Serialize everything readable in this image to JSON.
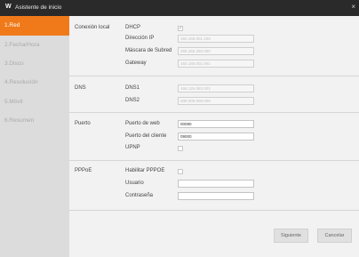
{
  "window": {
    "logo": "W",
    "title": "Asistente de inicio",
    "close_glyph": "×"
  },
  "sidebar": {
    "items": [
      {
        "label": "1.Red",
        "active": true
      },
      {
        "label": "2.Fecha/Hora",
        "active": false
      },
      {
        "label": "3.Disco",
        "active": false
      },
      {
        "label": "4.Resolución",
        "active": false
      },
      {
        "label": "5.Móvil",
        "active": false
      },
      {
        "label": "6.Resumen",
        "active": false
      }
    ]
  },
  "local": {
    "section_label": "Conexión local",
    "dhcp_label": "DHCP",
    "dhcp_checked": true,
    "ip_label": "Dirección IP",
    "ip_value": "192.168.001.100",
    "mask_label": "Máscara de Subred",
    "mask_value": "255.255.255.000",
    "gateway_label": "Gateway",
    "gateway_value": "192.168.001.001"
  },
  "dns": {
    "section_label": "DNS",
    "dns1_label": "DNS1",
    "dns1_value": "168.126.063.001",
    "dns2_label": "DNS2",
    "dns2_value": "008.008.008.008"
  },
  "port": {
    "section_label": "Puerto",
    "web_label": "Puerto de web",
    "web_value": "00080",
    "client_label": "Puerto del cliente",
    "client_value": "09000",
    "upnp_label": "UPNP",
    "upnp_checked": false
  },
  "pppoe": {
    "section_label": "PPPoE",
    "enable_label": "Habilitar PPPOE",
    "enable_checked": false,
    "user_label": "Usuario",
    "user_value": "",
    "password_label": "Contraseña",
    "password_value": ""
  },
  "buttons": {
    "next_label": "Siguiente",
    "cancel_label": "Cancelar"
  },
  "colors": {
    "accent": "#f07a1a",
    "titlebar": "#2a2a2a",
    "sidebar": "#dcdcdc"
  }
}
